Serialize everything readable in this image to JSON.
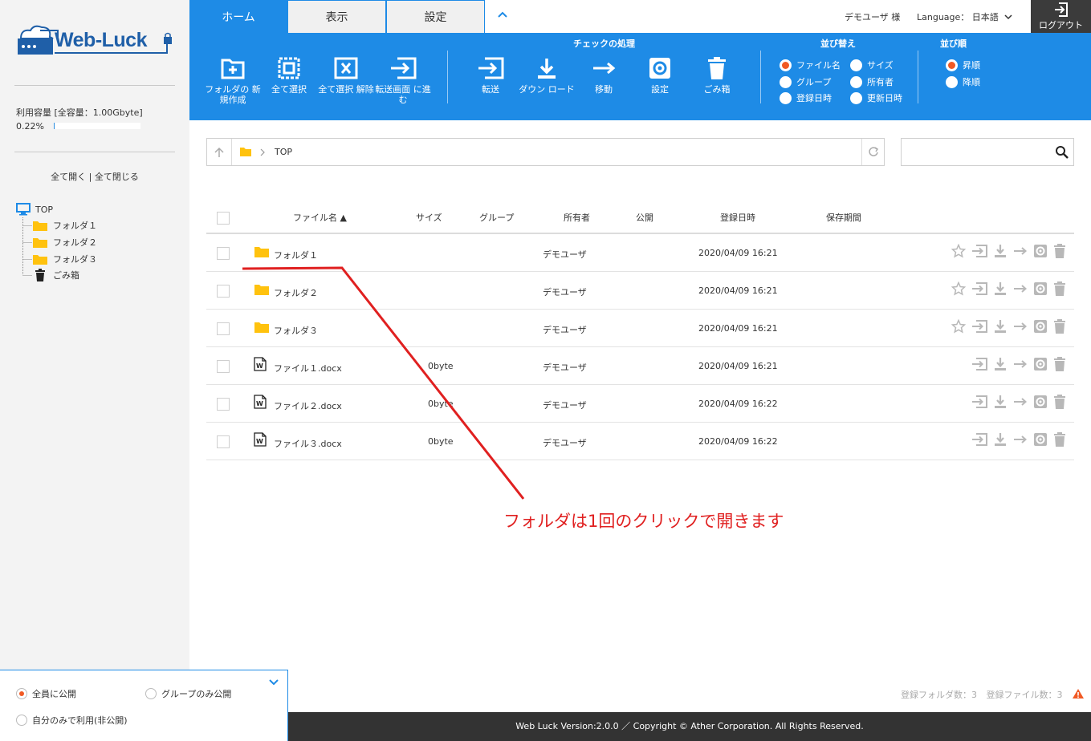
{
  "sidebar": {
    "logo_text": "Web-Luck",
    "usage_label": "利用容量 [全容量：1.00Gbyte]",
    "usage_percent_text": "0.22%",
    "usage_fraction": 0.0022,
    "expand_all": "全て開く",
    "separator": "|",
    "collapse_all": "全て閉じる",
    "tree": {
      "root": "TOP",
      "items": [
        "フォルダ１",
        "フォルダ２",
        "フォルダ３"
      ],
      "trash": "ごみ箱"
    }
  },
  "publish_panel": {
    "options": [
      "全員に公開",
      "グループのみ公開",
      "自分のみで利用(非公開)"
    ],
    "selected": "全員に公開"
  },
  "tabs": [
    {
      "label": "ホーム",
      "active": true
    },
    {
      "label": "表示",
      "active": false
    },
    {
      "label": "設定",
      "active": false
    }
  ],
  "header": {
    "user_name": "デモユーザ 様",
    "language_label": "Language：",
    "language_value": "日本語",
    "logout_label": "ログアウト"
  },
  "ribbon": {
    "buttons_left": [
      {
        "icon": "folder-plus-icon",
        "label": "フォルダの 新規作成"
      },
      {
        "icon": "select-all-icon",
        "label": "全て選択"
      },
      {
        "icon": "deselect-icon",
        "label": "全て選択 解除"
      },
      {
        "icon": "transfer-screen-icon",
        "label": "転送画面 に進む"
      }
    ],
    "check_group_title": "チェックの処理",
    "buttons_check": [
      {
        "icon": "send-icon",
        "label": "転送"
      },
      {
        "icon": "download-icon",
        "label": "ダウン ロード"
      },
      {
        "icon": "move-icon",
        "label": "移動"
      },
      {
        "icon": "settings-icon",
        "label": "設定"
      },
      {
        "icon": "trash-icon",
        "label": "ごみ箱"
      }
    ],
    "sort_title": "並び替え",
    "sort_options": [
      "ファイル名",
      "サイズ",
      "グループ",
      "所有者",
      "登録日時",
      "更新日時"
    ],
    "sort_selected": "ファイル名",
    "order_title": "並び順",
    "order_options": [
      "昇順",
      "降順"
    ],
    "order_selected": "昇順"
  },
  "path": {
    "current": "TOP"
  },
  "table": {
    "headers": {
      "name": "ファイル名",
      "sort_mark": "▲",
      "size": "サイズ",
      "group": "グループ",
      "owner": "所有者",
      "public": "公開",
      "date": "登録日時",
      "retention": "保存期間"
    },
    "rows": [
      {
        "type": "folder",
        "name": "フォルダ１",
        "size": "",
        "owner": "デモユーザ",
        "date": "2020/04/09 16:21"
      },
      {
        "type": "folder",
        "name": "フォルダ２",
        "size": "",
        "owner": "デモユーザ",
        "date": "2020/04/09 16:21"
      },
      {
        "type": "folder",
        "name": "フォルダ３",
        "size": "",
        "owner": "デモユーザ",
        "date": "2020/04/09 16:21"
      },
      {
        "type": "file",
        "name": "ファイル１.docx",
        "size": "0byte",
        "owner": "デモユーザ",
        "date": "2020/04/09 16:21"
      },
      {
        "type": "file",
        "name": "ファイル２.docx",
        "size": "0byte",
        "owner": "デモユーザ",
        "date": "2020/04/09 16:22"
      },
      {
        "type": "file",
        "name": "ファイル３.docx",
        "size": "0byte",
        "owner": "デモユーザ",
        "date": "2020/04/09 16:22"
      }
    ]
  },
  "annotation": "フォルダは1回のクリックで開きます",
  "status": {
    "folder_count": "登録フォルダ数：3",
    "file_count": "登録ファイル数：3"
  },
  "footer": "Web Luck Version:2.0.0 ／ Copyright © Ather Corporation. All Rights Reserved.",
  "colors": {
    "accent": "#1e8be6",
    "radio_selected": "#f15a24",
    "annotation": "#e02020",
    "folder": "#ffc20e"
  }
}
